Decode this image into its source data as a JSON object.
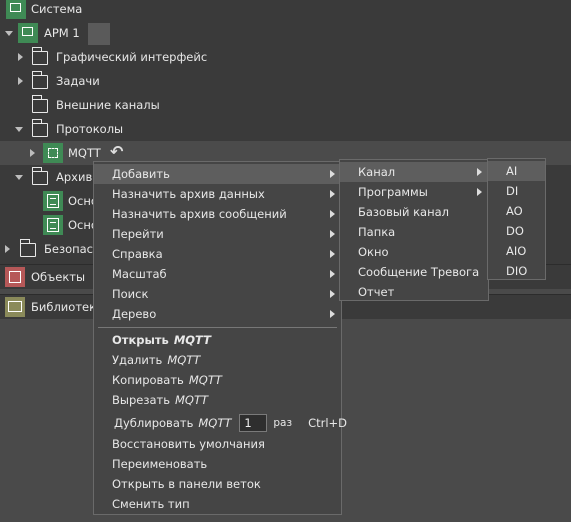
{
  "tree": {
    "sistema": "Система",
    "arm": "АРМ 1",
    "gui": "Графический интерфейс",
    "tasks": "Задачи",
    "ext_channels": "Внешние каналы",
    "protocols": "Протоколы",
    "mqtt": "MQTT",
    "archives": "Архивы",
    "osn1": "Осно",
    "osn2": "Осно",
    "security": "Безопасн"
  },
  "panels": {
    "objects": "Объекты",
    "libraries": "Библиотеки"
  },
  "main_menu": {
    "items": [
      "Добавить",
      "Назначить архив данных",
      "Назначить архив сообщений",
      "Перейти",
      "Справка",
      "Масштаб",
      "Поиск",
      "Дерево"
    ],
    "open": "Открыть",
    "delete": "Удалить",
    "copy": "Копировать",
    "cut": "Вырезать",
    "duplicate": "Дублировать",
    "object": "MQTT",
    "dup_count": "1",
    "dup_unit": "раз",
    "dup_shortcut": "Ctrl+D",
    "restore": "Восстановить умолчания",
    "rename": "Переименовать",
    "open_branch": "Открыть в панели веток",
    "change_type": "Сменить тип"
  },
  "add_menu": {
    "items": [
      "Канал",
      "Программы",
      "Базовый канал",
      "Папка",
      "Окно",
      "Сообщение Тревога",
      "Отчет"
    ]
  },
  "channel_menu": {
    "items": [
      "AI",
      "DI",
      "AO",
      "DO",
      "AIO",
      "DIO"
    ]
  }
}
